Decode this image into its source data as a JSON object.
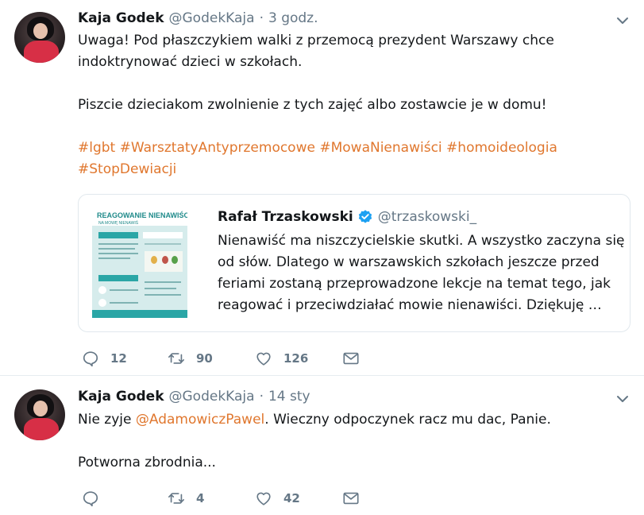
{
  "tweets": [
    {
      "display_name": "Kaja Godek",
      "handle": "@GodekKaja",
      "separator": "·",
      "time": "3 godz.",
      "lines": {
        "l1": "Uwaga! Pod płaszczykiem walki z przemocą prezydent Warszawy chce",
        "l2": "indoktrynować dzieci w szkołach.",
        "l3": "Piszcie dzieciakom zwolnienie z tych zajęć albo zostawcie je w domu!"
      },
      "hashtags": [
        "#lgbt",
        "#WarsztatyAntyprzemocowe",
        "#MowaNienawiści",
        "#homoideologia",
        "#StopDewiacji"
      ],
      "quote": {
        "display_name": "Rafał Trzaskowski",
        "handle": "@trzaskowski_",
        "lines": [
          "Nienawiść ma niszczycielskie skutki. A wszystko zaczyna się",
          "od słów. Dlatego w warszawskich szkołach jeszcze przed",
          "feriami zostaną przeprowadzone lekcje na temat tego, jak",
          "reagować i przeciwdziałać mowie nienawiści. Dziękuję …"
        ],
        "thumb_title": "REAGOWANIE NA MOWĘ NIENAWIŚCI",
        "thumb_title_l1": "REAGOWANIE NIENAWIŚCI",
        "thumb_title_l2": "NA MOWĘ NIENAWIŚ"
      },
      "actions": {
        "replies": "12",
        "retweets": "90",
        "likes": "126"
      }
    },
    {
      "display_name": "Kaja Godek",
      "handle": "@GodekKaja",
      "separator": "·",
      "time": "14 sty",
      "lines": {
        "l1_pre": "Nie zyje ",
        "l1_mention": "@AdamowiczPawel",
        "l1_post": ". Wieczny odpoczynek racz mu dac, Panie.",
        "l2": "Potworna zbrodnia..."
      },
      "actions": {
        "replies": "",
        "retweets": "4",
        "likes": "42"
      }
    }
  ],
  "colors": {
    "accent": "#e0772e",
    "muted": "#657786",
    "verified": "#1da1f2",
    "divider": "#e6ecf0"
  },
  "icons": [
    "caret-down-icon",
    "reply-icon",
    "retweet-icon",
    "like-icon",
    "direct-message-icon",
    "verified-badge-icon"
  ]
}
